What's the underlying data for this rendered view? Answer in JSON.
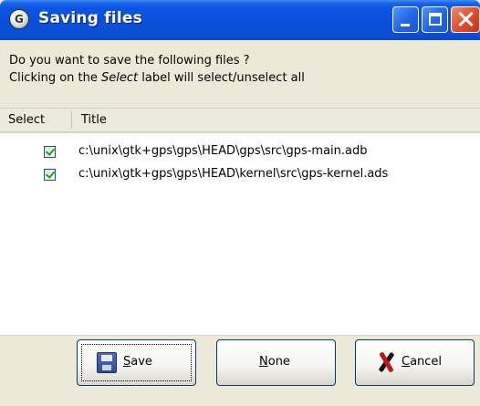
{
  "window": {
    "title": "Saving files"
  },
  "prompt": {
    "line1": "Do you want to save the following files ?",
    "line2_prefix": "Clicking on the ",
    "line2_em": "Select",
    "line2_suffix": " label will select/unselect all"
  },
  "list": {
    "columns": [
      "Select",
      "Title"
    ],
    "rows": [
      {
        "checked": true,
        "title": "c:\\unix\\gtk+gps\\gps\\HEAD\\gps\\src\\gps-main.adb"
      },
      {
        "checked": true,
        "title": "c:\\unix\\gtk+gps\\gps\\HEAD\\kernel\\src\\gps-kernel.ads"
      }
    ]
  },
  "buttons": {
    "save": {
      "mnemonic": "S",
      "rest": "ave"
    },
    "none": {
      "mnemonic": "N",
      "rest": "one"
    },
    "cancel": {
      "mnemonic": "C",
      "rest": "ancel"
    }
  },
  "icons": {
    "app": "gps-app-icon",
    "save": "floppy-disk-icon",
    "cancel": "red-x-icon"
  }
}
